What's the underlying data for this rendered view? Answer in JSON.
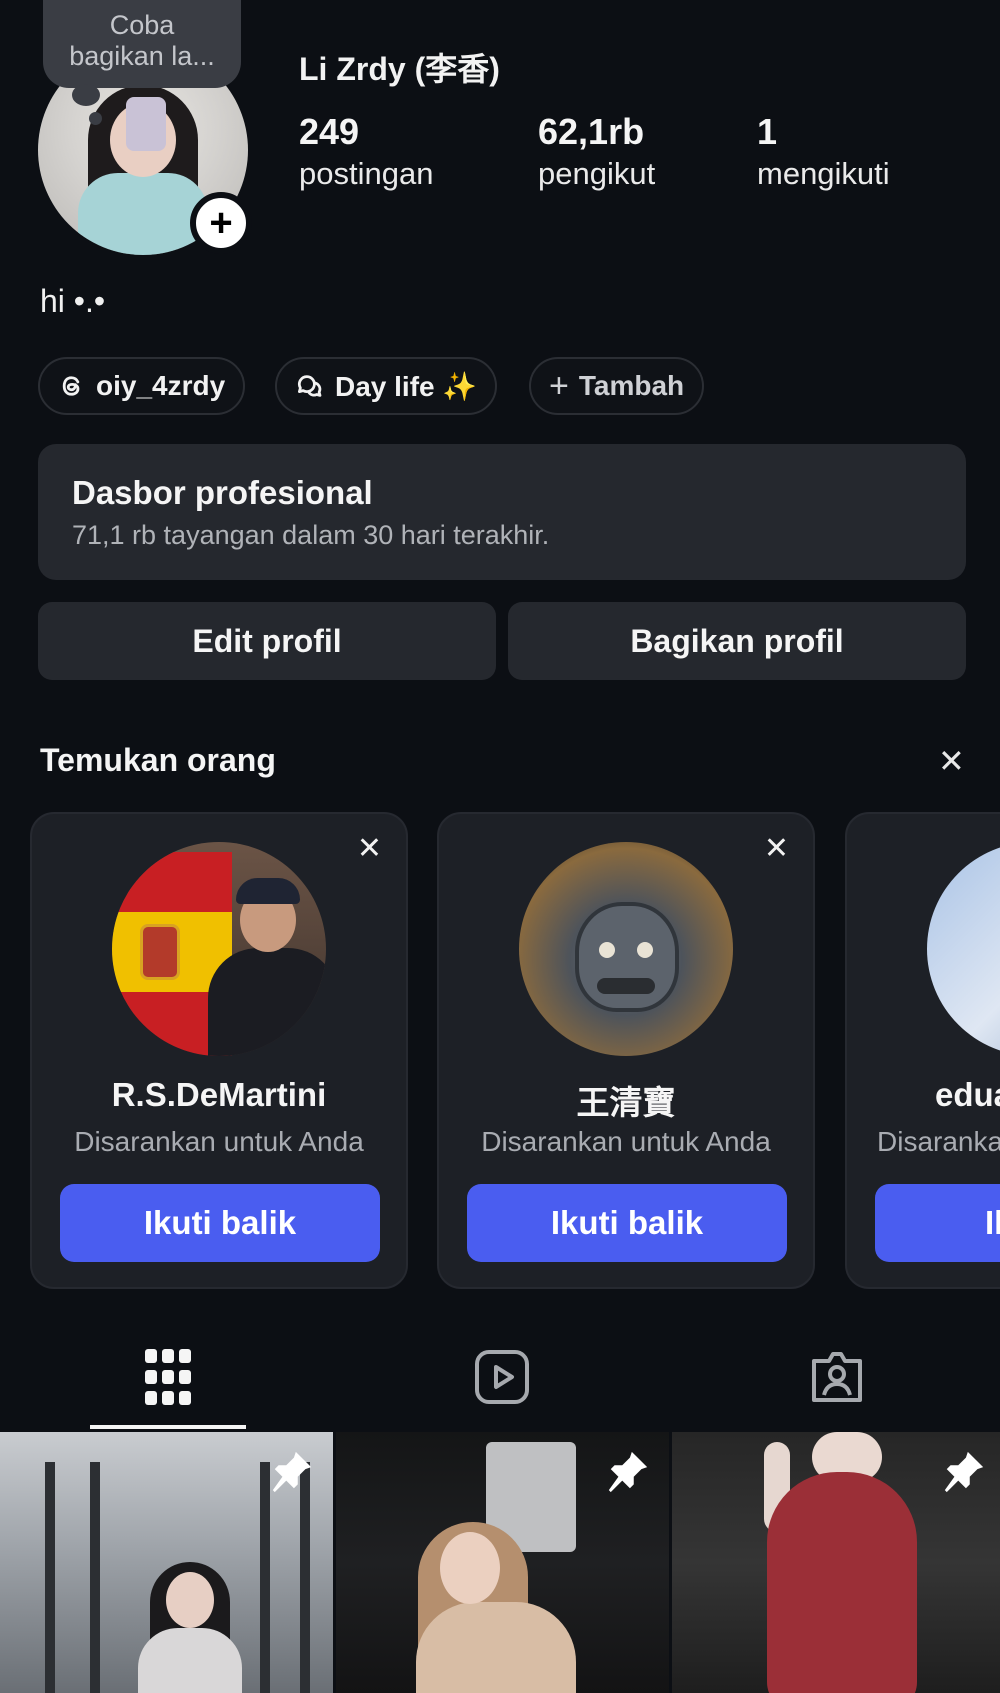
{
  "profile": {
    "note_line1": "Coba",
    "note_line2": "bagikan la...",
    "username": "Li Zrdy (李香)",
    "stats": [
      {
        "value": "249",
        "label": "postingan"
      },
      {
        "value": "62,1rb",
        "label": "pengikut"
      },
      {
        "value": "1",
        "label": "mengikuti"
      }
    ],
    "bio": "hi •.•"
  },
  "chips": [
    {
      "icon": "threads-icon",
      "label": "oiy_4zrdy"
    },
    {
      "icon": "chat-bubbles-icon",
      "label": "Day life ✨"
    },
    {
      "icon": "plus-icon",
      "label": "Tambah"
    }
  ],
  "dashboard": {
    "title": "Dasbor profesional",
    "subtitle": "71,1 rb tayangan dalam 30 hari terakhir."
  },
  "buttons": {
    "edit": "Edit profil",
    "share": "Bagikan profil"
  },
  "discover": {
    "title": "Temukan orang",
    "close_glyph": "✕",
    "cards": [
      {
        "name": "R.S.DeMartini",
        "subtitle": "Disarankan untuk Anda",
        "action": "Ikuti balik"
      },
      {
        "name": "王清寶",
        "subtitle": "Disarankan untuk Anda",
        "action": "Ikuti balik"
      },
      {
        "name": "edua",
        "subtitle": "Disaranka",
        "action": "Iku"
      }
    ]
  },
  "tabs": [
    {
      "icon": "grid-icon",
      "active": true
    },
    {
      "icon": "reels-icon",
      "active": false
    },
    {
      "icon": "tagged-icon",
      "active": false
    }
  ],
  "colors": {
    "background": "#0c0f14",
    "card": "#1d2026",
    "button_gray": "#25282e",
    "accent_blue": "#4a5df0"
  }
}
